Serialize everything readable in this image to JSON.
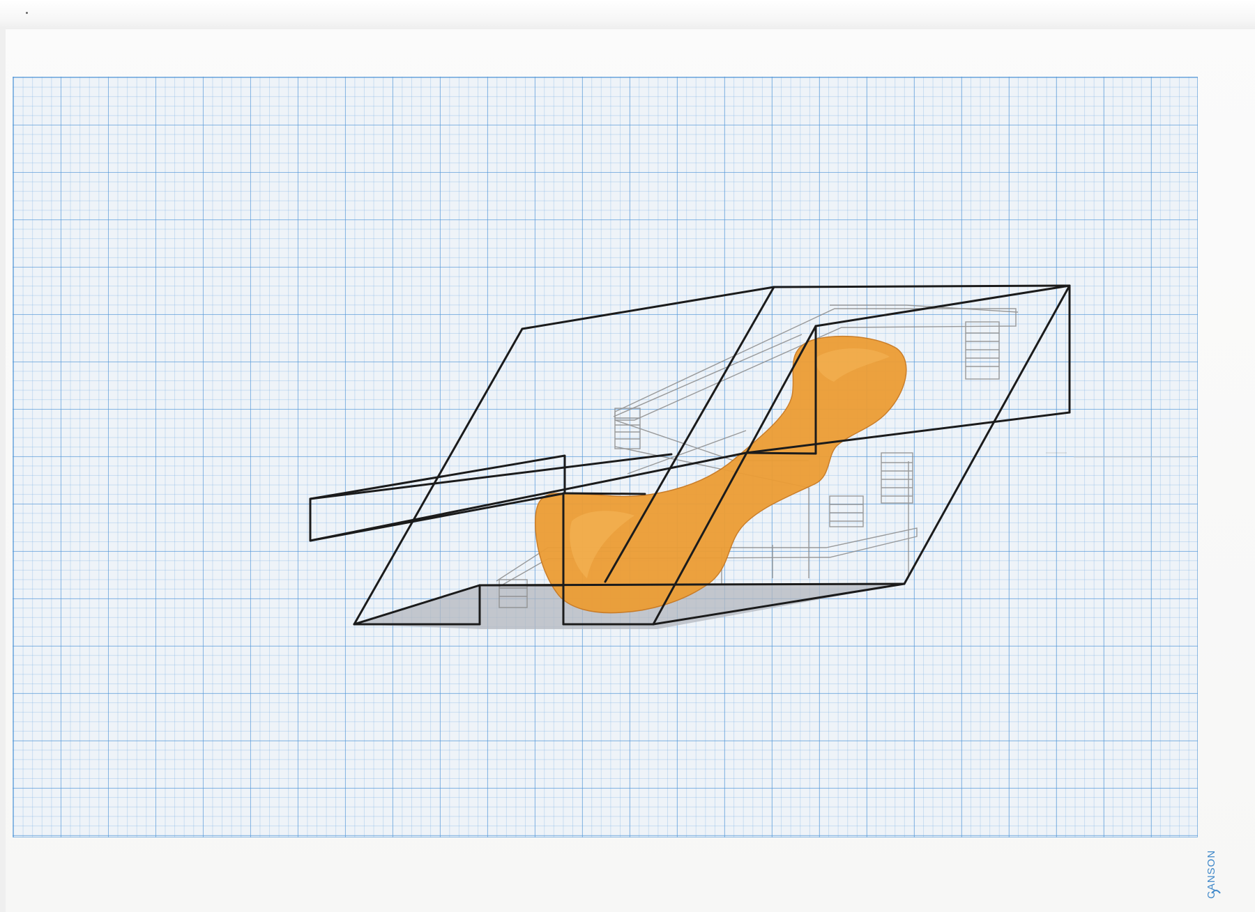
{
  "sheet": {
    "paper_color": "#fbfbfb",
    "grid_color": "#4f94d6",
    "grid_background": "#eef3f8"
  },
  "drawing": {
    "line_color": "#1b1b1b",
    "pencil_color": "#8a8a8a",
    "volume_color": "#ec9d35",
    "volume_highlight": "#f6b85a",
    "shadow_color": "#b3b7bf"
  },
  "brand": {
    "text": "CANSON",
    "color": "#3f88c9"
  }
}
